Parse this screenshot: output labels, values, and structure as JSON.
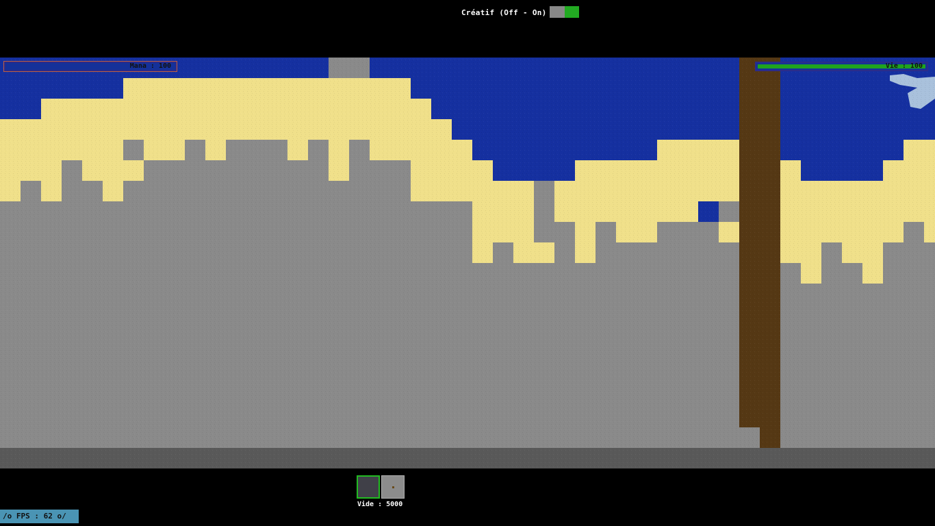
{
  "hud": {
    "creative_label": "Créatif (Off - On)",
    "creative_mode_on": true,
    "mana_label": "Mana : 100",
    "mana_fraction": 1.0,
    "life_label": "Vie : 100",
    "life_fraction": 1.0
  },
  "inventory": {
    "selected_slot": 0,
    "item_label": "Vide : 5000"
  },
  "status": {
    "fps_text": "/o FPS :   62 o/"
  },
  "colors": {
    "sky": "#1530a0",
    "sand": "#f0e08a",
    "stone": "#8a8a8a",
    "bedrock": "#595959",
    "wood": "#553814",
    "cloud": "#a9c1dc",
    "toggle_on": "#22aa22",
    "life": "#1fa31f"
  }
}
